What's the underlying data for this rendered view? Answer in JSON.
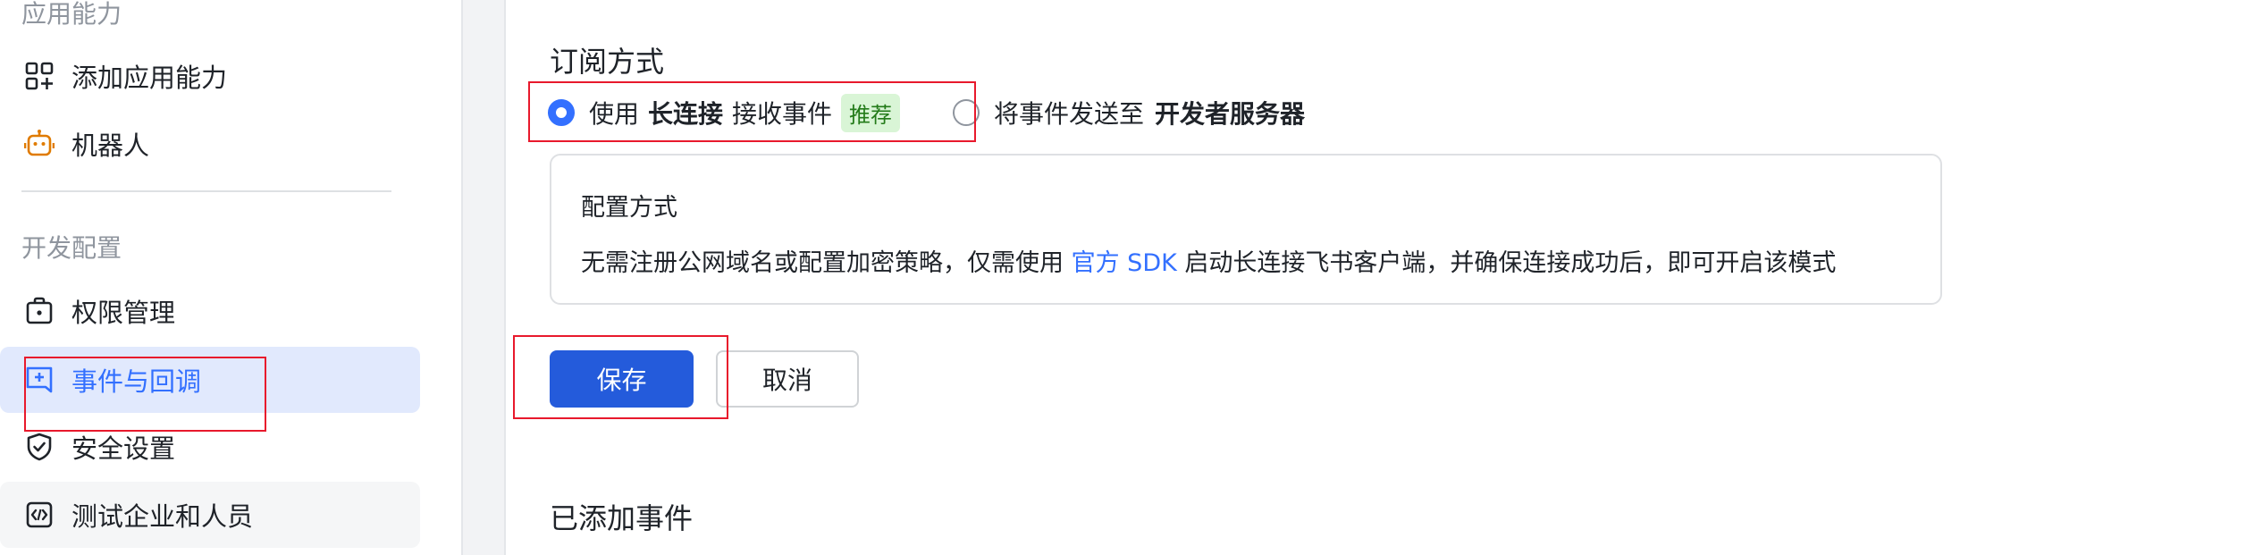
{
  "sidebar": {
    "section_app": "应用能力",
    "items_app": [
      {
        "label": "添加应用能力",
        "icon": "add-grid-icon"
      },
      {
        "label": "机器人",
        "icon": "robot-icon"
      }
    ],
    "section_dev": "开发配置",
    "items_dev": [
      {
        "label": "权限管理",
        "icon": "permission-icon"
      },
      {
        "label": "事件与回调",
        "icon": "event-callback-icon",
        "active": true
      },
      {
        "label": "安全设置",
        "icon": "shield-icon"
      },
      {
        "label": "测试企业和人员",
        "icon": "code-icon"
      }
    ]
  },
  "main": {
    "subscribe_title": "订阅方式",
    "option_long_conn": {
      "prefix": "使用",
      "bold": "长连接",
      "suffix": "接收事件",
      "tag": "推荐",
      "checked": true
    },
    "option_server": {
      "prefix": "将事件发送至",
      "bold": "开发者服务器",
      "checked": false
    },
    "config": {
      "title": "配置方式",
      "desc_before": "无需注册公网域名或配置加密策略，仅需使用",
      "desc_link": "官方 SDK",
      "desc_after": "启动长连接飞书客户端，并确保连接成功后，即可开启该模式"
    },
    "save_label": "保存",
    "cancel_label": "取消",
    "added_events_title": "已添加事件"
  },
  "colors": {
    "accent": "#3370ff",
    "primary_button": "#245bdb",
    "active_bg": "#e1e9fd",
    "tag_bg": "#d9f5d6",
    "tag_text": "#237b19",
    "highlight_box": "#e8192c"
  }
}
